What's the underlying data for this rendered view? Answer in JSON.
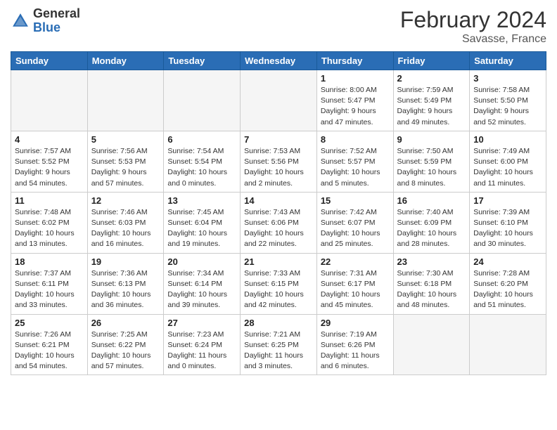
{
  "logo": {
    "general": "General",
    "blue": "Blue"
  },
  "title": "February 2024",
  "subtitle": "Savasse, France",
  "weekdays": [
    "Sunday",
    "Monday",
    "Tuesday",
    "Wednesday",
    "Thursday",
    "Friday",
    "Saturday"
  ],
  "weeks": [
    [
      {
        "day": "",
        "info": "",
        "empty": true
      },
      {
        "day": "",
        "info": "",
        "empty": true
      },
      {
        "day": "",
        "info": "",
        "empty": true
      },
      {
        "day": "",
        "info": "",
        "empty": true
      },
      {
        "day": "1",
        "info": "Sunrise: 8:00 AM\nSunset: 5:47 PM\nDaylight: 9 hours\nand 47 minutes.",
        "empty": false
      },
      {
        "day": "2",
        "info": "Sunrise: 7:59 AM\nSunset: 5:49 PM\nDaylight: 9 hours\nand 49 minutes.",
        "empty": false
      },
      {
        "day": "3",
        "info": "Sunrise: 7:58 AM\nSunset: 5:50 PM\nDaylight: 9 hours\nand 52 minutes.",
        "empty": false
      }
    ],
    [
      {
        "day": "4",
        "info": "Sunrise: 7:57 AM\nSunset: 5:52 PM\nDaylight: 9 hours\nand 54 minutes.",
        "empty": false
      },
      {
        "day": "5",
        "info": "Sunrise: 7:56 AM\nSunset: 5:53 PM\nDaylight: 9 hours\nand 57 minutes.",
        "empty": false
      },
      {
        "day": "6",
        "info": "Sunrise: 7:54 AM\nSunset: 5:54 PM\nDaylight: 10 hours\nand 0 minutes.",
        "empty": false
      },
      {
        "day": "7",
        "info": "Sunrise: 7:53 AM\nSunset: 5:56 PM\nDaylight: 10 hours\nand 2 minutes.",
        "empty": false
      },
      {
        "day": "8",
        "info": "Sunrise: 7:52 AM\nSunset: 5:57 PM\nDaylight: 10 hours\nand 5 minutes.",
        "empty": false
      },
      {
        "day": "9",
        "info": "Sunrise: 7:50 AM\nSunset: 5:59 PM\nDaylight: 10 hours\nand 8 minutes.",
        "empty": false
      },
      {
        "day": "10",
        "info": "Sunrise: 7:49 AM\nSunset: 6:00 PM\nDaylight: 10 hours\nand 11 minutes.",
        "empty": false
      }
    ],
    [
      {
        "day": "11",
        "info": "Sunrise: 7:48 AM\nSunset: 6:02 PM\nDaylight: 10 hours\nand 13 minutes.",
        "empty": false
      },
      {
        "day": "12",
        "info": "Sunrise: 7:46 AM\nSunset: 6:03 PM\nDaylight: 10 hours\nand 16 minutes.",
        "empty": false
      },
      {
        "day": "13",
        "info": "Sunrise: 7:45 AM\nSunset: 6:04 PM\nDaylight: 10 hours\nand 19 minutes.",
        "empty": false
      },
      {
        "day": "14",
        "info": "Sunrise: 7:43 AM\nSunset: 6:06 PM\nDaylight: 10 hours\nand 22 minutes.",
        "empty": false
      },
      {
        "day": "15",
        "info": "Sunrise: 7:42 AM\nSunset: 6:07 PM\nDaylight: 10 hours\nand 25 minutes.",
        "empty": false
      },
      {
        "day": "16",
        "info": "Sunrise: 7:40 AM\nSunset: 6:09 PM\nDaylight: 10 hours\nand 28 minutes.",
        "empty": false
      },
      {
        "day": "17",
        "info": "Sunrise: 7:39 AM\nSunset: 6:10 PM\nDaylight: 10 hours\nand 30 minutes.",
        "empty": false
      }
    ],
    [
      {
        "day": "18",
        "info": "Sunrise: 7:37 AM\nSunset: 6:11 PM\nDaylight: 10 hours\nand 33 minutes.",
        "empty": false
      },
      {
        "day": "19",
        "info": "Sunrise: 7:36 AM\nSunset: 6:13 PM\nDaylight: 10 hours\nand 36 minutes.",
        "empty": false
      },
      {
        "day": "20",
        "info": "Sunrise: 7:34 AM\nSunset: 6:14 PM\nDaylight: 10 hours\nand 39 minutes.",
        "empty": false
      },
      {
        "day": "21",
        "info": "Sunrise: 7:33 AM\nSunset: 6:15 PM\nDaylight: 10 hours\nand 42 minutes.",
        "empty": false
      },
      {
        "day": "22",
        "info": "Sunrise: 7:31 AM\nSunset: 6:17 PM\nDaylight: 10 hours\nand 45 minutes.",
        "empty": false
      },
      {
        "day": "23",
        "info": "Sunrise: 7:30 AM\nSunset: 6:18 PM\nDaylight: 10 hours\nand 48 minutes.",
        "empty": false
      },
      {
        "day": "24",
        "info": "Sunrise: 7:28 AM\nSunset: 6:20 PM\nDaylight: 10 hours\nand 51 minutes.",
        "empty": false
      }
    ],
    [
      {
        "day": "25",
        "info": "Sunrise: 7:26 AM\nSunset: 6:21 PM\nDaylight: 10 hours\nand 54 minutes.",
        "empty": false
      },
      {
        "day": "26",
        "info": "Sunrise: 7:25 AM\nSunset: 6:22 PM\nDaylight: 10 hours\nand 57 minutes.",
        "empty": false
      },
      {
        "day": "27",
        "info": "Sunrise: 7:23 AM\nSunset: 6:24 PM\nDaylight: 11 hours\nand 0 minutes.",
        "empty": false
      },
      {
        "day": "28",
        "info": "Sunrise: 7:21 AM\nSunset: 6:25 PM\nDaylight: 11 hours\nand 3 minutes.",
        "empty": false
      },
      {
        "day": "29",
        "info": "Sunrise: 7:19 AM\nSunset: 6:26 PM\nDaylight: 11 hours\nand 6 minutes.",
        "empty": false
      },
      {
        "day": "",
        "info": "",
        "empty": true
      },
      {
        "day": "",
        "info": "",
        "empty": true
      }
    ]
  ]
}
